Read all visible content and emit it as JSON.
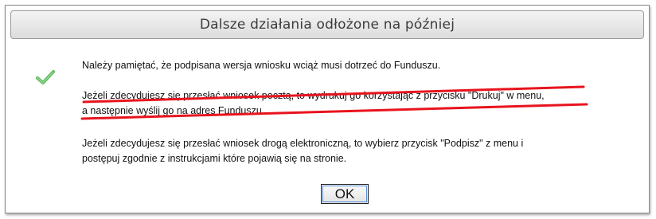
{
  "dialog": {
    "title": "Dalsze działania odłożone na później",
    "icon": "check-icon",
    "message_1": "Należy pamiętać, że podpisana wersja wniosku wciąż musi dotrzeć do Funduszu.",
    "message_2_line_1": "Jeżeli zdecydujesz się przesłać wniosek pocztą, to wydrukuj go korzystając z przycisku \"Drukuj\" w menu,",
    "message_2_line_2": "a następnie wyślij go na adres Funduszu.",
    "message_3_line_1": "Jeżeli zdecydujesz się przesłać wniosek drogą elektroniczną, to wybierz przycisk \"Podpisz\" z menu i",
    "message_3_line_2": "postępuj zgodnie z instrukcjami które pojawią się na stronie.",
    "ok_label": "OK",
    "strike_color": "#e8141e",
    "check_color": "#5cb85c"
  }
}
